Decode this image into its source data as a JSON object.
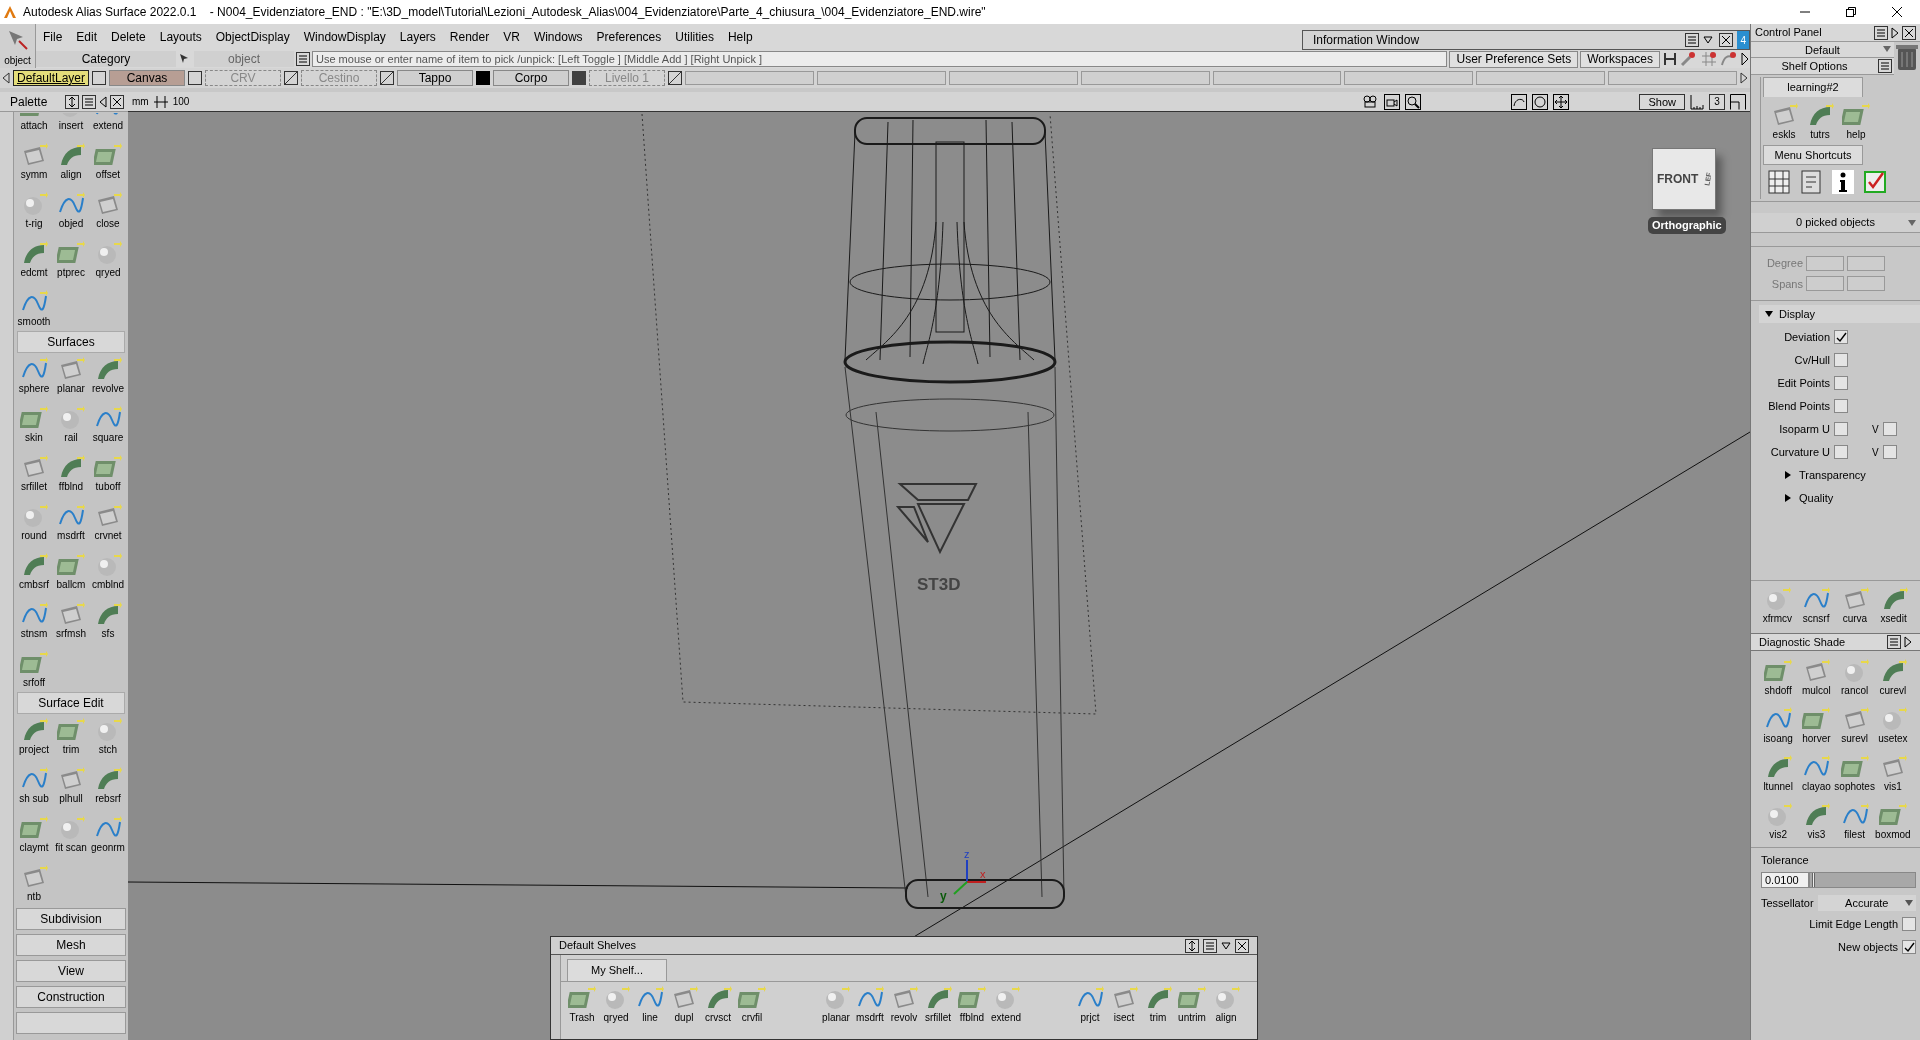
{
  "title_bar": {
    "title": "Autodesk Alias Surface 2022.0.1    - N004_Evidenziatore_END : \"E:\\3D_model\\Tutorial\\Lezioni_Autodesk_Alias\\004_Evidenziatore\\Parte_4_chiusura_\\004_Evidenziatore_END.wire\""
  },
  "menu_bar": {
    "object_tool": "object",
    "items": [
      "File",
      "Edit",
      "Delete",
      "Layouts",
      "ObjectDisplay",
      "WindowDisplay",
      "Layers",
      "Render",
      "VR",
      "Windows",
      "Preferences",
      "Utilities",
      "Help"
    ]
  },
  "information_window": {
    "title": "Information Window",
    "badge": "4"
  },
  "pick_bar": {
    "category": "Category",
    "object_field": "object",
    "prompt": "Use mouse or enter name of item to pick /unpick: [Left Toggle ] [Middle Add ] [Right Unpick ]",
    "buttons": [
      "User Preference Sets",
      "Workspaces"
    ]
  },
  "layers": [
    {
      "name": "DefaultLayer",
      "kind": "normal",
      "selected": true
    },
    {
      "name": "Canvas",
      "kind": "canvas",
      "selected": false
    },
    {
      "name": "CRV",
      "kind": "hidden",
      "selected": false
    },
    {
      "name": "Cestino",
      "kind": "hidden",
      "selected": false
    },
    {
      "name": "Tappo",
      "kind": "normal",
      "selected": false,
      "color": "#000000"
    },
    {
      "name": "Corpo",
      "kind": "normal",
      "selected": false,
      "color": "#404040"
    },
    {
      "name": "Livello 1",
      "kind": "hidden",
      "selected": false
    }
  ],
  "palette": {
    "title": "Palette",
    "sections": [
      {
        "tools": [
          "attach",
          "insert",
          "extend",
          "symm",
          "align",
          "offset",
          "t-rig",
          "objed",
          "close",
          "edcmt",
          "ptprec",
          "qryed",
          "smooth"
        ]
      },
      {
        "title": "Surfaces",
        "tools": [
          "sphere",
          "planar",
          "revolve",
          "skin",
          "rail",
          "square",
          "srfillet",
          "ffblnd",
          "tuboff",
          "round",
          "msdrft",
          "crvnet",
          "cmbsrf",
          "ballcm",
          "cmblnd",
          "stnsm",
          "srfmsh",
          "sfs",
          "srfoff"
        ]
      },
      {
        "title": "Surface Edit",
        "tools": [
          "project",
          "trim",
          "stch",
          "sh sub",
          "plhull",
          "rebsrf",
          "claymt",
          "fit scan",
          "geonrm",
          "ntb"
        ]
      }
    ],
    "collapsed_sections": [
      "Subdivision",
      "Mesh",
      "View",
      "Construction"
    ]
  },
  "viewport": {
    "unit": "mm",
    "grid": "100",
    "show_button": "Show",
    "layout_button": "3",
    "cube_front": "FRONT",
    "cube_side": "LEF",
    "projection": "Orthographic",
    "model_label": "ST3D",
    "axes": [
      "z",
      "x",
      "y"
    ]
  },
  "shelves": {
    "title": "Default Shelves",
    "tab": "My Shelf...",
    "groups": [
      [
        "Trash",
        "qryed",
        "line",
        "dupl",
        "crvsct",
        "crvfil"
      ],
      [
        "planar",
        "msdrft",
        "revolv",
        "srfillet",
        "ffblnd",
        "extend"
      ],
      [
        "prjct",
        "isect",
        "trim",
        "untrim",
        "align"
      ]
    ]
  },
  "control_panel": {
    "title": "Control Panel",
    "preset": "Default",
    "shelf_options": "Shelf Options",
    "tab": "learning#2",
    "tab_tools": [
      "eskls",
      "tutrs",
      "help"
    ],
    "menu_shortcuts": "Menu Shortcuts",
    "picked": "0 picked objects",
    "fields": [
      "Degree",
      "Spans"
    ],
    "display": {
      "title": "Display",
      "expanded": true,
      "options": [
        {
          "label": "Deviation",
          "checked": true
        },
        {
          "label": "Cv/Hull",
          "checked": false
        },
        {
          "label": "Edit Points",
          "checked": false
        },
        {
          "label": "Blend Points",
          "checked": false
        },
        {
          "label": "Isoparm U",
          "checked": false,
          "v_label": "V",
          "v_checked": false
        },
        {
          "label": "Curvature U",
          "checked": false,
          "v_label": "V",
          "v_checked": false
        }
      ],
      "subsections": [
        {
          "title": "Transparency",
          "expanded": false
        },
        {
          "title": "Quality",
          "expanded": false
        }
      ]
    },
    "tools": [
      "xfrmcv",
      "scnsrf",
      "curva",
      "xsedit"
    ]
  },
  "diagnostic_shade": {
    "title": "Diagnostic Shade",
    "tools": [
      "shdoff",
      "mulcol",
      "rancol",
      "curevl",
      "isoang",
      "horver",
      "surevl",
      "usetex",
      "ltunnel",
      "clayao",
      "sophotes",
      "vis1",
      "vis2",
      "vis3",
      "filest",
      "boxmod"
    ],
    "tolerance_label": "Tolerance",
    "tolerance": "0.0100",
    "tolerance_slider": {
      "level": 0.02
    },
    "tessellator_label": "Tessellator",
    "tessellator": "Accurate",
    "options": [
      {
        "label": "Limit Edge Length",
        "checked": false
      },
      {
        "label": "New objects",
        "checked": true
      }
    ]
  }
}
